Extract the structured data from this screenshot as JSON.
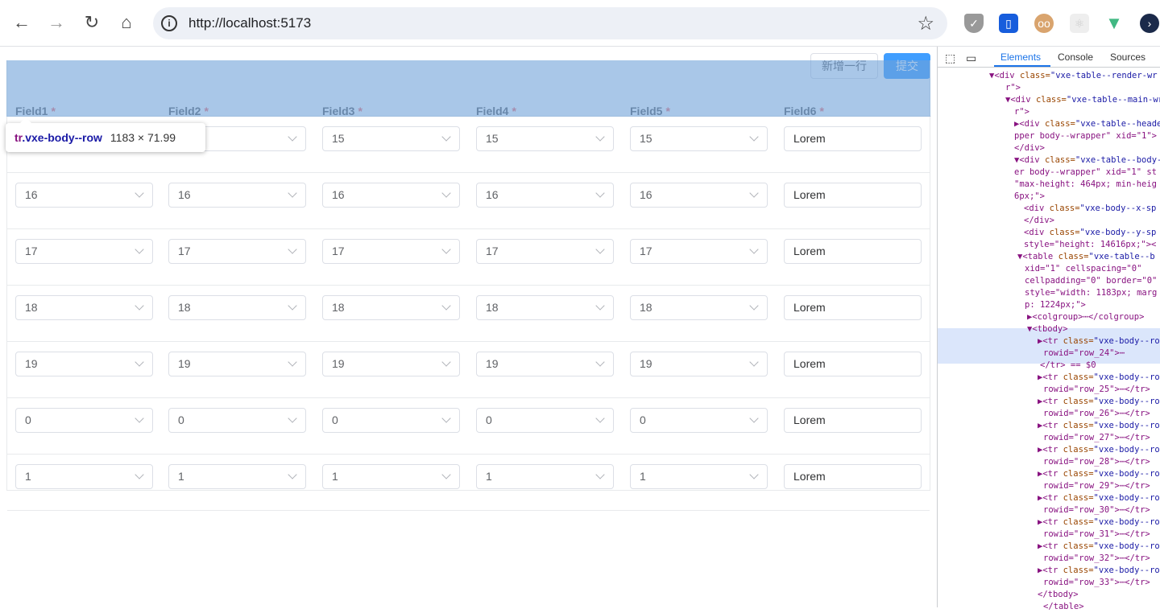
{
  "browser": {
    "url": "http://localhost:5173",
    "icons": [
      "back-icon",
      "forward-icon",
      "reload-icon",
      "home-icon",
      "info-icon",
      "bookmark-star-icon"
    ],
    "extensions": [
      "shield-extension-icon",
      "bitwarden-extension-icon",
      "avatar-extension-icon",
      "react-devtools-icon",
      "vue-devtools-icon",
      "hex-extension-icon"
    ]
  },
  "toolbar": {
    "add_row": "新增一行",
    "submit": "提交"
  },
  "table": {
    "columns": [
      "Field1",
      "Field2",
      "Field3",
      "Field4",
      "Field5",
      "Field6"
    ],
    "required_mark": "*",
    "rows": [
      [
        "15",
        "15",
        "15",
        "15",
        "15",
        "Lorem"
      ],
      [
        "16",
        "16",
        "16",
        "16",
        "16",
        "Lorem"
      ],
      [
        "17",
        "17",
        "17",
        "17",
        "17",
        "Lorem"
      ],
      [
        "18",
        "18",
        "18",
        "18",
        "18",
        "Lorem"
      ],
      [
        "19",
        "19",
        "19",
        "19",
        "19",
        "Lorem"
      ],
      [
        "0",
        "0",
        "0",
        "0",
        "0",
        "Lorem"
      ],
      [
        "1",
        "1",
        "1",
        "1",
        "1",
        "Lorem"
      ]
    ]
  },
  "inspector_tip": {
    "tag": "tr",
    "cls": ".vxe-body--row",
    "dim": "1183 × 71.99"
  },
  "devtools": {
    "tabs": [
      "Elements",
      "Console",
      "Sources"
    ],
    "lines": [
      [
        "▼<div ",
        "class=",
        "\"vxe-table--render-wr"
      ],
      [
        "r\">",
        "",
        ""
      ],
      [
        "▼<div ",
        "class=",
        "\"vxe-table--main-wr"
      ],
      [
        "r\">",
        "",
        ""
      ],
      [
        "▶<div ",
        "class=",
        "\"vxe-table--heade"
      ],
      [
        "pper body--wrapper\" xid=\"1\">",
        "",
        ""
      ],
      [
        "</div>",
        "",
        ""
      ],
      [
        "▼<div ",
        "class=",
        "\"vxe-table--body-"
      ],
      [
        "er body--wrapper\" xid=\"1\" st",
        "",
        ""
      ],
      [
        "\"max-height: 464px; min-heig",
        "",
        ""
      ],
      [
        "6px;\">",
        "",
        ""
      ],
      [
        "<div ",
        "class=",
        "\"vxe-body--x-sp"
      ],
      [
        "</div>",
        "",
        ""
      ],
      [
        "<div ",
        "class=",
        "\"vxe-body--y-sp"
      ],
      [
        "style=\"height: 14616px;\"><",
        "",
        ""
      ],
      [
        "▼<table ",
        "class=",
        "\"vxe-table--b"
      ],
      [
        "xid=\"1\" cellspacing=\"0\"",
        "",
        ""
      ],
      [
        "cellpadding=\"0\" border=\"0\"",
        "",
        ""
      ],
      [
        "style=\"width: 1183px; marg",
        "",
        ""
      ],
      [
        "p: 1224px;\">",
        "",
        ""
      ],
      [
        "▶<colgroup>⋯</colgroup>",
        "",
        ""
      ],
      [
        "▼<tbody>",
        "",
        ""
      ],
      [
        "▶<tr ",
        "class=",
        "\"vxe-body--ro"
      ],
      [
        "rowid=\"row_24\">⋯",
        "",
        ""
      ],
      [
        "</tr> == $0",
        "",
        ""
      ],
      [
        "▶<tr ",
        "class=",
        "\"vxe-body--ro"
      ],
      [
        "rowid=\"row_25\">⋯</tr>",
        "",
        ""
      ],
      [
        "▶<tr ",
        "class=",
        "\"vxe-body--ro"
      ],
      [
        "rowid=\"row_26\">⋯</tr>",
        "",
        ""
      ],
      [
        "▶<tr ",
        "class=",
        "\"vxe-body--ro"
      ],
      [
        "rowid=\"row_27\">⋯</tr>",
        "",
        ""
      ],
      [
        "▶<tr ",
        "class=",
        "\"vxe-body--ro"
      ],
      [
        "rowid=\"row_28\">⋯</tr>",
        "",
        ""
      ],
      [
        "▶<tr ",
        "class=",
        "\"vxe-body--ro"
      ],
      [
        "rowid=\"row_29\">⋯</tr>",
        "",
        ""
      ],
      [
        "▶<tr ",
        "class=",
        "\"vxe-body--ro"
      ],
      [
        "rowid=\"row_30\">⋯</tr>",
        "",
        ""
      ],
      [
        "▶<tr ",
        "class=",
        "\"vxe-body--ro"
      ],
      [
        "rowid=\"row_31\">⋯</tr>",
        "",
        ""
      ],
      [
        "▶<tr ",
        "class=",
        "\"vxe-body--ro"
      ],
      [
        "rowid=\"row_32\">⋯</tr>",
        "",
        ""
      ],
      [
        "▶<tr ",
        "class=",
        "\"vxe-body--ro"
      ],
      [
        "rowid=\"row_33\">⋯</tr>",
        "",
        ""
      ],
      [
        "</tbody>",
        "",
        ""
      ],
      [
        "</table>",
        "",
        ""
      ]
    ]
  }
}
